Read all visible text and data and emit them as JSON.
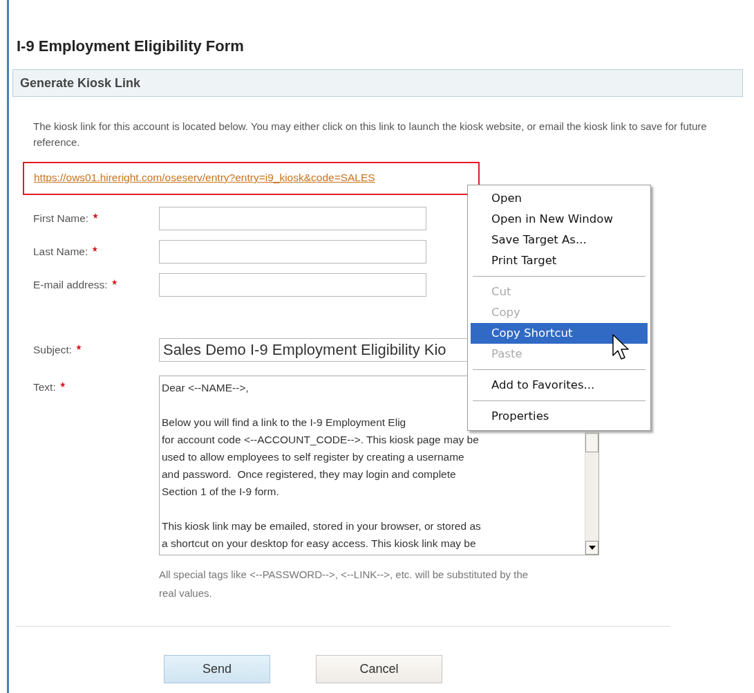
{
  "page_title": "I-9 Employment Eligibility Form",
  "section": {
    "title": "Generate Kiosk Link"
  },
  "intro": "The kiosk link for this account is located below. You may either click on this link to launch the kiosk website, or email the kiosk link to save for future reference.",
  "kiosk_link": {
    "text": "https://ows01.hireright.com/oseserv/entry?entry=i9_kiosk&code=SALES",
    "highlighted": true
  },
  "fields": [
    {
      "kind": "input",
      "label": "First Name:",
      "required": true
    },
    {
      "kind": "input",
      "label": "Last Name:",
      "required": true
    },
    {
      "kind": "input",
      "label": "E-mail address:",
      "required": true
    },
    {
      "kind": "subject",
      "label": "Subject:",
      "required": true,
      "value": "Sales Demo I-9 Employment Eligibility Kio"
    },
    {
      "kind": "textarea",
      "label": "Text:",
      "required": true,
      "paragraphs": [
        [
          "Dear <--NAME-->,"
        ],
        [
          "Below you will find a link to the I-9 Employment Elig",
          "for account code <--ACCOUNT_CODE-->. This kiosk page may be",
          "used to allow employees to self register by creating a username",
          "and password.  Once registered, they may login and complete",
          "Section 1 of the I-9 form."
        ],
        [
          "This kiosk link may be emailed, stored in your browser, or stored as",
          "a shortcut on your desktop for easy access. This kiosk link may be"
        ]
      ]
    }
  ],
  "help_text": "All special tags like <--PASSWORD-->, <--LINK-->, etc. will be substituted by the real values.",
  "buttons": [
    {
      "label": "Send",
      "kind": "primary"
    },
    {
      "label": "Cancel",
      "kind": "secondary"
    }
  ],
  "context_menu": {
    "items": [
      {
        "kind": "item",
        "label": "Open",
        "disabled": false,
        "selected": false
      },
      {
        "kind": "item",
        "label": "Open in New Window",
        "disabled": false,
        "selected": false
      },
      {
        "kind": "item",
        "label": "Save Target As...",
        "disabled": false,
        "selected": false
      },
      {
        "kind": "item",
        "label": "Print Target",
        "disabled": false,
        "selected": false
      },
      {
        "kind": "separator"
      },
      {
        "kind": "item",
        "label": "Cut",
        "disabled": true,
        "selected": false
      },
      {
        "kind": "item",
        "label": "Copy",
        "disabled": true,
        "selected": false
      },
      {
        "kind": "item",
        "label": "Copy Shortcut",
        "disabled": false,
        "selected": true
      },
      {
        "kind": "item",
        "label": "Paste",
        "disabled": true,
        "selected": false
      },
      {
        "kind": "separator"
      },
      {
        "kind": "item",
        "label": "Add to Favorites...",
        "disabled": false,
        "selected": false
      },
      {
        "kind": "separator"
      },
      {
        "kind": "item",
        "label": "Properties",
        "disabled": false,
        "selected": false
      }
    ]
  }
}
